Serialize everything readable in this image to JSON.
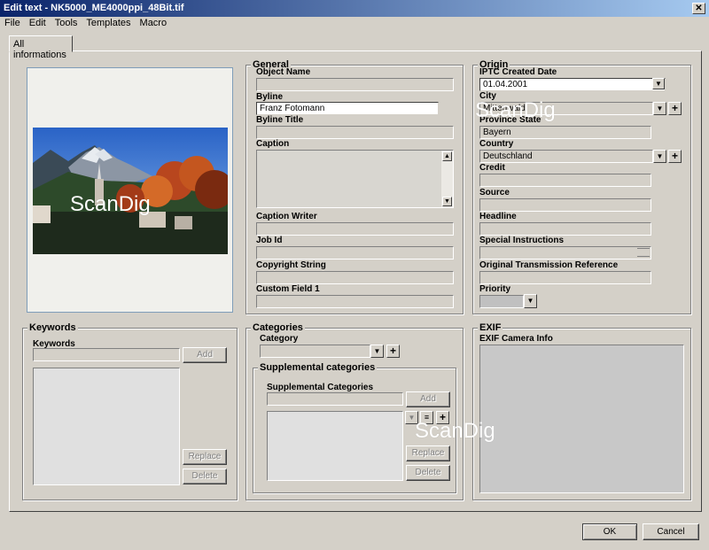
{
  "window": {
    "title": "Edit text - NK5000_ME4000ppi_48Bit.tif",
    "close_glyph": "✕"
  },
  "menu": [
    "File",
    "Edit",
    "Tools",
    "Templates",
    "Macro"
  ],
  "tabs": [
    {
      "label": "All informations"
    }
  ],
  "watermark": "ScanDig",
  "general": {
    "title": "General",
    "object_name_label": "Object Name",
    "object_name": "",
    "byline_label": "Byline",
    "byline": "Franz Fotomann",
    "byline_title_label": "Byline Title",
    "byline_title": "",
    "caption_label": "Caption",
    "caption": "",
    "caption_writer_label": "Caption Writer",
    "caption_writer": "",
    "job_id_label": "Job Id",
    "job_id": "",
    "copyright_label": "Copyright String",
    "copyright": "",
    "custom1_label": "Custom Field 1",
    "custom1": ""
  },
  "origin": {
    "title": "Origin",
    "iptc_date_label": "IPTC Created Date",
    "iptc_date": "01.04.2001",
    "city_label": "City",
    "city": "Mittenwald",
    "province_label": "Province State",
    "province": "Bayern",
    "country_label": "Country",
    "country": "Deutschland",
    "credit_label": "Credit",
    "credit": "",
    "source_label": "Source",
    "source": "",
    "headline_label": "Headline",
    "headline": "",
    "special_label": "Special Instructions",
    "special": "",
    "otr_label": "Original Transmission Reference",
    "otr": "",
    "priority_label": "Priority",
    "priority": ""
  },
  "keywords": {
    "title": "Keywords",
    "label": "Keywords",
    "input": "",
    "add": "Add",
    "replace": "Replace",
    "delete": "Delete"
  },
  "categories": {
    "title": "Categories",
    "category_label": "Category",
    "category": "",
    "supp_title": "Supplemental categories",
    "supp_label": "Supplemental Categories",
    "supp_input": "",
    "add": "Add",
    "replace": "Replace",
    "delete": "Delete"
  },
  "exif": {
    "title": "EXIF",
    "label": "EXIF Camera Info"
  },
  "footer": {
    "ok": "OK",
    "cancel": "Cancel"
  },
  "colors": {
    "face": "#d4d0c8",
    "titlebar_start": "#0a246a",
    "titlebar_end": "#a6caf0",
    "preview_bg": "#f0f0ec"
  }
}
